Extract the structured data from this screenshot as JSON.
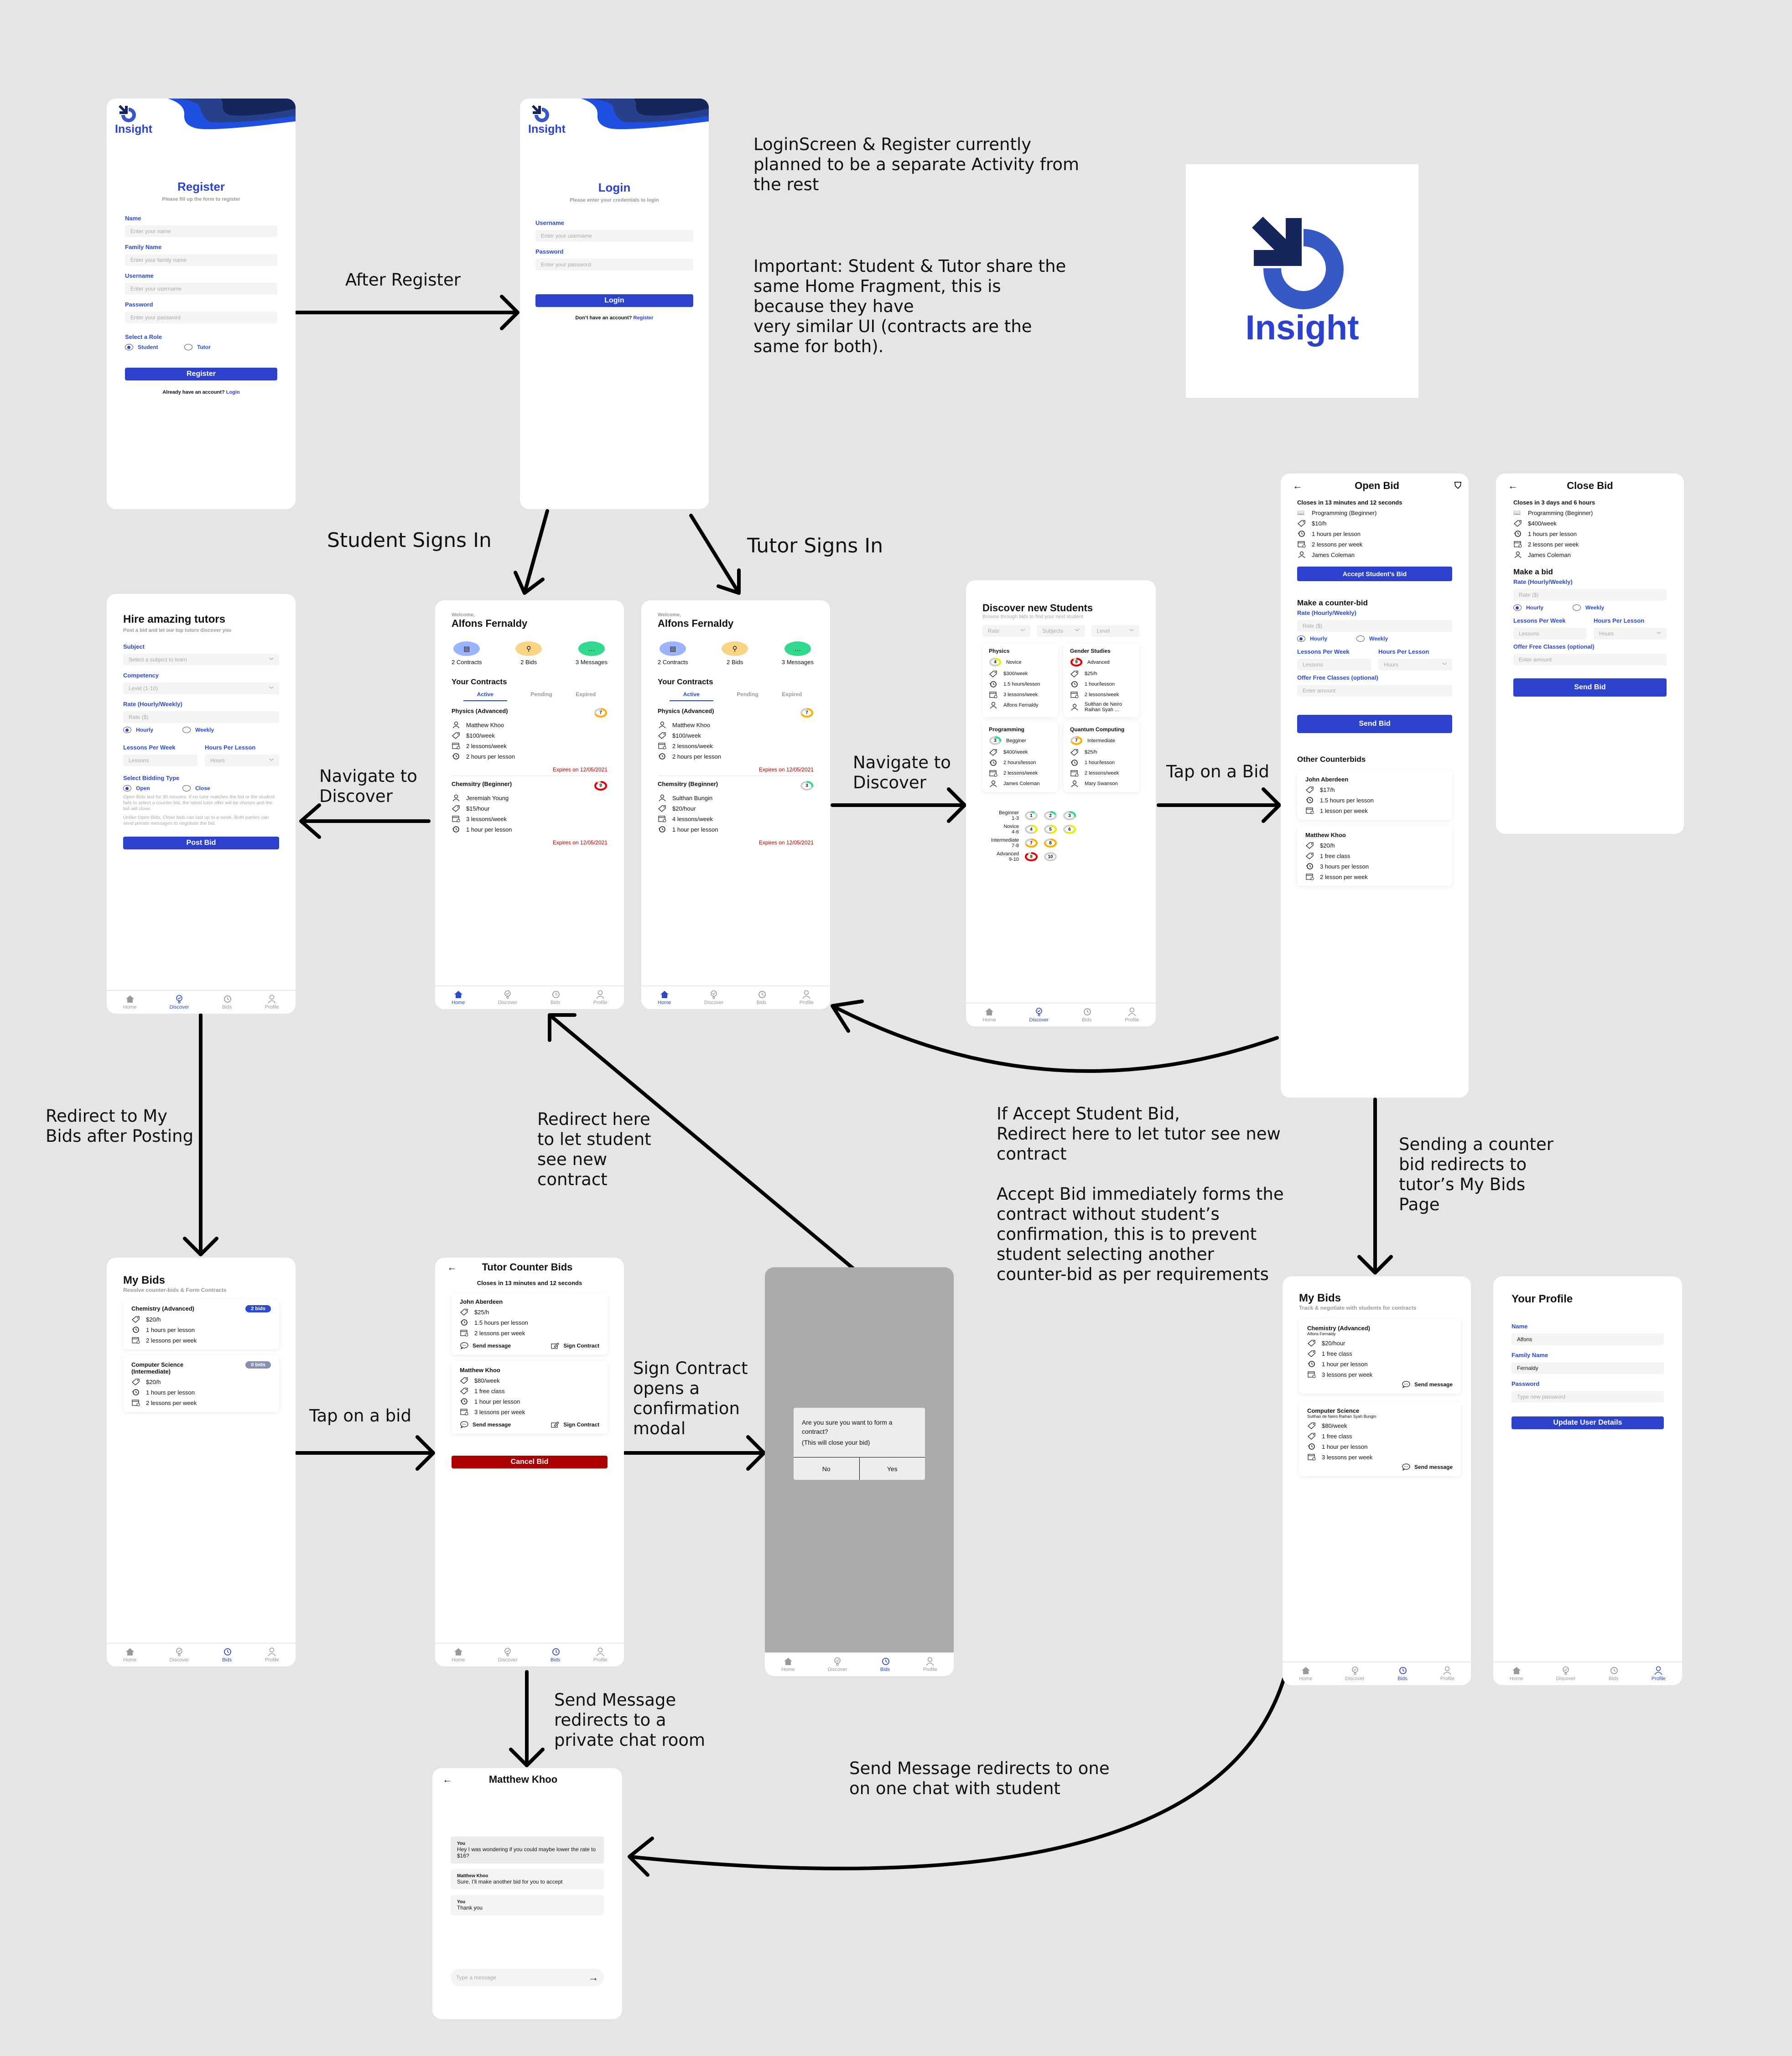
{
  "colors": {
    "brand": "#2c41cc",
    "brand_dark": "#16265c",
    "danger": "#ad0000",
    "canvas": "#e5e5e5"
  },
  "logo": {
    "text": "Insight"
  },
  "notes": {
    "login_separate": "LoginScreen & Register currently\nplanned to be a separate Activity from\nthe rest",
    "shared_home": "Important: Student & Tutor share the\nsame Home Fragment, this is\nbecause they have\nvery similar UI (contracts are the\nsame for both).",
    "after_register": "After Register",
    "student_signs_in": "Student Signs In",
    "tutor_signs_in": "Tutor Signs In",
    "navigate_discover_left": "Navigate to\nDiscover",
    "navigate_discover_right": "Navigate to\nDiscover",
    "tap_on_bid_right": "Tap on a Bid",
    "redirect_my_bids": "Redirect to My\nBids after Posting",
    "redirect_student": "Redirect here\nto let student\nsee new\ncontract",
    "accept_student_bid": "If Accept Student Bid,\nRedirect here to let tutor see new\ncontract\n\nAccept Bid immediately forms the\ncontract without student’s\nconfirmation, this is to prevent\nstudent selecting another\ncounter-bid as per requirements",
    "counter_redirect": "Sending a counter\nbid redirects to\ntutor’s My Bids\nPage",
    "tap_on_bid_left": "Tap on a bid",
    "sign_contract_modal": "Sign Contract\nopens a\nconfirmation\nmodal",
    "send_message_private": "Send Message\nredirects to a\nprivate chat room",
    "send_message_student": "Send Message redirects to one\non one chat with student"
  },
  "nav": {
    "home": "Home",
    "discover": "Discover",
    "bids": "Bids",
    "profile": "Profile"
  },
  "register": {
    "title": "Register",
    "subtitle": "Please fill up the form to register",
    "name_label": "Name",
    "name_placeholder": "Enter your name",
    "family_label": "Family Name",
    "family_placeholder": "Enter your family name",
    "username_label": "Username",
    "username_placeholder": "Enter your username",
    "password_label": "Password",
    "password_placeholder": "Enter your password",
    "role_label": "Select a Role",
    "role_student": "Student",
    "role_tutor": "Tutor",
    "button": "Register",
    "footer_text": "Already have an account?",
    "footer_link": "Login"
  },
  "login": {
    "title": "Login",
    "subtitle": "Please enter your credentials to login",
    "username_label": "Username",
    "username_placeholder": "Enter your username",
    "password_label": "Password",
    "password_placeholder": "Enter your password",
    "button": "Login",
    "footer_text": "Don’t have an account?",
    "footer_link": "Register"
  },
  "post_bid": {
    "title": "Hire amazing tutors",
    "subtitle": "Post a bid and let our top tutors discover you",
    "subject_label": "Subject",
    "subject_placeholder": "Select a subject to learn",
    "competency_label": "Competency",
    "competency_placeholder": "Level (1-10)",
    "rate_label": "Rate (Hourly/Weekly)",
    "rate_placeholder": "Rate ($)",
    "hourly": "Hourly",
    "weekly": "Weekly",
    "lessons_label": "Lessons Per Week",
    "lessons_placeholder": "Lessons",
    "hours_label": "Hours Per Lesson",
    "hours_placeholder": "Hours",
    "bidding_label": "Select Bidding Type",
    "open": "Open",
    "close": "Close",
    "open_desc": "Open Bids last for 30 minutes. If no tutor matches the bid or the student fails to select a counter bid, the latest tutor offer will be chosen and the bid will close.",
    "close_desc": "Unlike Open Bids, Close bids can last up to a week. Both parties can send private messages to negotiate the bid.",
    "button": "Post Bid"
  },
  "home_student": {
    "welcome": "Welcome,",
    "name": "Alfons Fernaldy",
    "stats": [
      {
        "label": "2 Contracts"
      },
      {
        "label": "2 Bids"
      },
      {
        "label": "3 Messages"
      }
    ],
    "contracts_title": "Your Contracts",
    "tabs": [
      "Active",
      "Pending",
      "Expired"
    ],
    "contracts": [
      {
        "title": "Physics (Advanced)",
        "person": "Matthew Khoo",
        "rate": "$100/week",
        "lessons": "2 lessons/week",
        "hours": "2 hours per lesson",
        "expires": "Expires on 12/05/2021",
        "level": "7",
        "level_fraction": 0.7,
        "ring_color": "#ffb000"
      },
      {
        "title": "Chemsitry (Beginner)",
        "person": "Jeremiah Young",
        "rate": "$15/hour",
        "lessons": "3 lessons/week",
        "hours": "1 hour per lesson",
        "expires": "Expires on 12/05/2021",
        "level": "9",
        "level_fraction": 0.9,
        "ring_color": "#e60000"
      }
    ]
  },
  "home_tutor": {
    "welcome": "Welcome,",
    "name": "Alfons Fernaldy",
    "stats": [
      {
        "label": "2 Contracts"
      },
      {
        "label": "2 Bids"
      },
      {
        "label": "3 Messages"
      }
    ],
    "contracts_title": "Your Contracts",
    "tabs": [
      "Active",
      "Pending",
      "Expired"
    ],
    "contracts": [
      {
        "title": "Physics (Advanced)",
        "person": "Matthew Khoo",
        "rate": "$100/week",
        "lessons": "2 lessons/week",
        "hours": "2 hours per lesson",
        "expires": "Expires on 12/05/2021",
        "level": "7",
        "level_fraction": 0.7,
        "ring_color": "#ffb000"
      },
      {
        "title": "Chemsitry (Beginner)",
        "person": "Sulthan Bungin",
        "rate": "$20/hour",
        "lessons": "4 lessons/week",
        "hours": "1 hour per lesson",
        "expires": "Expires on 12/05/2021",
        "level": "3",
        "level_fraction": 0.3,
        "ring_color": "#22dd88"
      }
    ]
  },
  "discover": {
    "title": "Discover new Students",
    "subtitle": "Browse through bids to find your next student",
    "filters": [
      "Rate",
      "Subjects",
      "Level"
    ],
    "cards": [
      {
        "subject": "Physics",
        "level": "4",
        "level_name": "Novice",
        "rate": "$300/week",
        "hours": "1.5 hours/lesson",
        "lessons": "3 lessons/week",
        "student": "Alfons Fernaldy",
        "ring_color": "#e8f000",
        "level_fraction": 0.4
      },
      {
        "subject": "Gender Studies",
        "level": "9",
        "level_name": "Advanced",
        "rate": "$25/h",
        "hours": "1 hour/lesson",
        "lessons": "2 lessons/week",
        "student": "Sulthan de Neiro Raihan Syah ...",
        "ring_color": "#e60000",
        "level_fraction": 0.9
      },
      {
        "subject": "Programming",
        "level": "3",
        "level_name": "Begginer",
        "rate": "$400/week",
        "hours": "2 hours/lesson",
        "lessons": "2 lessons/week",
        "student": "James Coleman",
        "ring_color": "#22dd88",
        "level_fraction": 0.3
      },
      {
        "subject": "Quantum Computing",
        "level": "7",
        "level_name": "Intermediate",
        "rate": "$25/h",
        "hours": "1 hour/lesson",
        "lessons": "2 lessons/week",
        "student": "Mary Swanson",
        "ring_color": "#ffb000",
        "level_fraction": 0.7
      }
    ],
    "legend": [
      {
        "name": "Beginner",
        "range": "1-3",
        "levels": [
          "1",
          "2",
          "3"
        ],
        "color": "#22dd88"
      },
      {
        "name": "Novice",
        "range": "4-6",
        "levels": [
          "4",
          "5",
          "6"
        ],
        "color": "#e8f000"
      },
      {
        "name": "Intermediate",
        "range": "7-8",
        "levels": [
          "7",
          "8"
        ],
        "color": "#ffb000"
      },
      {
        "name": "Advanced",
        "range": "9-10",
        "levels": [
          "9",
          "10"
        ],
        "color": "#e60000"
      }
    ]
  },
  "open_bid": {
    "title": "Open Bid",
    "closes": "Closes in 13 minutes and 12 seconds",
    "subject": "Programming (Beginner)",
    "rate": "$10/h",
    "hours": "1 hours per lesson",
    "lessons": "2 lessons per week",
    "student": "James Coleman",
    "accept_button": "Accept Student’s Bid",
    "counter_title": "Make a counter-bid",
    "rate_label": "Rate (Hourly/Weekly)",
    "rate_placeholder": "Rate ($)",
    "hourly": "Hourly",
    "weekly": "Weekly",
    "lessons_label": "Lessons Per Week",
    "lessons_placeholder": "Lessons",
    "hours_label": "Hours Per Lesson",
    "hours_placeholder": "Hours",
    "free_label": "Offer Free Classes (optional)",
    "free_placeholder": "Enter amount",
    "send_button": "Send Bid",
    "others_title": "Other Counterbids",
    "others": [
      {
        "name": "John Aberdeen",
        "rows": [
          "$17/h",
          "1.5 hours per lesson",
          "1 lesson per week"
        ],
        "icons": [
          "tag",
          "clock",
          "calendar"
        ]
      },
      {
        "name": "Matthew Khoo",
        "rows": [
          "$20/h",
          "1 free class",
          "3 hours per lesson",
          "2 lesson per week"
        ],
        "icons": [
          "tag",
          "tag",
          "clock",
          "calendar"
        ]
      }
    ]
  },
  "close_bid": {
    "title": "Close Bid",
    "closes": "Closes in 3 days and 6 hours",
    "subject": "Programming (Beginner)",
    "rate": "$400/week",
    "hours": "1 hours per lesson",
    "lessons": "2 lessons per week",
    "student": "James Coleman",
    "make_title": "Make a bid",
    "rate_label": "Rate (Hourly/Weekly)",
    "rate_placeholder": "Rate ($)",
    "hourly": "Hourly",
    "weekly": "Weekly",
    "lessons_label": "Lessons Per Week",
    "lessons_placeholder": "Lessons",
    "hours_label": "Hours Per Lesson",
    "hours_placeholder": "Hours",
    "free_label": "Offer Free Classes (optional)",
    "free_placeholder": "Enter amount",
    "send_button": "Send Bid"
  },
  "my_bids_student": {
    "title": "My Bids",
    "subtitle": "Resolve counter-bids & Form Contracts",
    "bids": [
      {
        "title": "Chemistry (Advanced)",
        "badge": "2 bids",
        "badge_color": "#2c4acb",
        "rate": "$20/h",
        "hours": "1 hours per lesson",
        "lessons": "2 lessons per week"
      },
      {
        "title": "Computer Science (Intermediate)",
        "badge": "0 bids",
        "badge_color": "#8590b3",
        "rate": "$20/h",
        "hours": "1 hours per lesson",
        "lessons": "2 lessons per week"
      }
    ]
  },
  "counter_bids": {
    "title": "Tutor Counter Bids",
    "closes": "Closes in 13 minutes and 12 seconds",
    "send_message": "Send message",
    "sign_contract": "Sign Contract",
    "bids": [
      {
        "name": "John Aberdeen",
        "rows": [
          "$25/h",
          "1.5 hours per lesson",
          "2 lessons per week"
        ],
        "icons": [
          "tag",
          "clock",
          "calendar"
        ]
      },
      {
        "name": "Matthew Khoo",
        "rows": [
          "$80/week",
          "1 free class",
          "1 hour per lesson",
          "3 lessons per week"
        ],
        "icons": [
          "tag",
          "tag",
          "clock",
          "calendar"
        ]
      }
    ],
    "cancel_button": "Cancel Bid"
  },
  "modal": {
    "question": "Are you sure you want to form a contract?",
    "note": "(This will close your bid)",
    "no": "No",
    "yes": "Yes"
  },
  "my_bids_tutor": {
    "title": "My Bids",
    "subtitle": "Track & negotiate with students for contracts",
    "send_message": "Send message",
    "bids": [
      {
        "title": "Chemistry (Advanced)",
        "student": "Alfons Fernaldy",
        "rows": [
          "$20/hour",
          "1 free class",
          "1 hour per lesson",
          "3 lessons per week"
        ]
      },
      {
        "title": "Computer Science",
        "student": "Sulthan de Neiro Raihan Syah Bungin",
        "rows": [
          "$80/week",
          "1 free class",
          "1 hour per lesson",
          "3 lessons per week"
        ]
      }
    ]
  },
  "profile": {
    "title": "Your Profile",
    "name_label": "Name",
    "name_value": "Alfons",
    "family_label": "Family Name",
    "family_value": "Fernaldy",
    "password_label": "Password",
    "password_placeholder": "Type new password",
    "button": "Update User Details"
  },
  "chat": {
    "title": "Matthew Khoo",
    "messages": [
      {
        "sender": "You",
        "text": "Hey I was wondering if you could maybe lower the rate to $16?"
      },
      {
        "sender": "Matthew Khoo",
        "text": "Sure, I’ll make another bid for you to accept"
      },
      {
        "sender": "You",
        "text": "Thank you"
      }
    ],
    "input_placeholder": "Type a message"
  }
}
